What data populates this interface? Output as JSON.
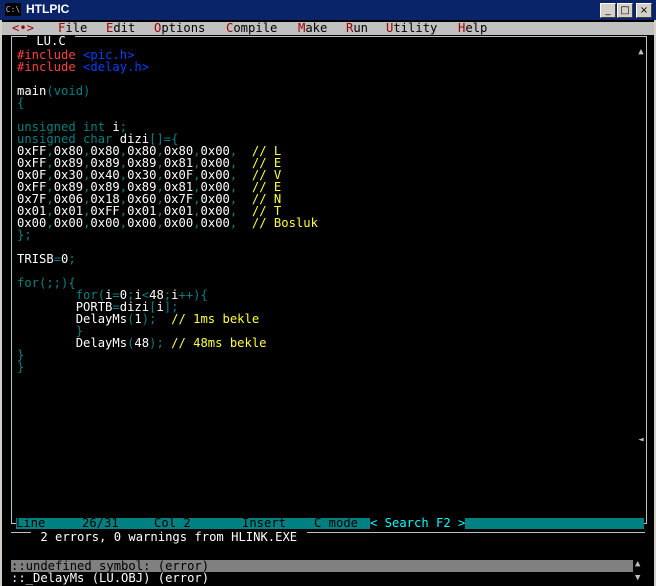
{
  "window": {
    "title": "HTLPIC",
    "icon": "console-icon",
    "min": "_",
    "max": "□",
    "close": "×"
  },
  "menu": [
    {
      "pre": "",
      "hk": "<•>",
      "post": ""
    },
    {
      "pre": "",
      "hk": "F",
      "post": "ile"
    },
    {
      "pre": "",
      "hk": "E",
      "post": "dit"
    },
    {
      "pre": "",
      "hk": "O",
      "post": "ptions"
    },
    {
      "pre": "",
      "hk": "C",
      "post": "ompile"
    },
    {
      "pre": "",
      "hk": "M",
      "post": "ake"
    },
    {
      "pre": "",
      "hk": "R",
      "post": "un"
    },
    {
      "pre": "",
      "hk": "U",
      "post": "tility"
    },
    {
      "pre": "",
      "hk": "H",
      "post": "elp"
    }
  ],
  "editor": {
    "file_title": " LU.C ",
    "lines": [
      [
        {
          "c": "rd",
          "t": "#include "
        },
        {
          "c": "bl",
          "t": "<pic.h>"
        }
      ],
      [
        {
          "c": "rd",
          "t": "#include "
        },
        {
          "c": "bl",
          "t": "<delay.h>"
        }
      ],
      [],
      [
        {
          "c": "wt",
          "t": "main"
        },
        {
          "c": "dk",
          "t": "(void)"
        }
      ],
      [
        {
          "c": "dk",
          "t": "{"
        }
      ],
      [],
      [
        {
          "c": "dk",
          "t": "unsigned int "
        },
        {
          "c": "wt",
          "t": "i"
        },
        {
          "c": "dk",
          "t": ";"
        }
      ],
      [
        {
          "c": "dk",
          "t": "unsigned char "
        },
        {
          "c": "wt",
          "t": "dizi"
        },
        {
          "c": "dk",
          "t": "[]={"
        }
      ],
      [
        {
          "c": "wt",
          "t": "0xFF"
        },
        {
          "c": "dk",
          "t": ","
        },
        {
          "c": "wt",
          "t": "0x80"
        },
        {
          "c": "dk",
          "t": ","
        },
        {
          "c": "wt",
          "t": "0x80"
        },
        {
          "c": "dk",
          "t": ","
        },
        {
          "c": "wt",
          "t": "0x80"
        },
        {
          "c": "dk",
          "t": ","
        },
        {
          "c": "wt",
          "t": "0x80"
        },
        {
          "c": "dk",
          "t": ","
        },
        {
          "c": "wt",
          "t": "0x00"
        },
        {
          "c": "dk",
          "t": ",  "
        },
        {
          "c": "yl",
          "t": "// L"
        }
      ],
      [
        {
          "c": "wt",
          "t": "0xFF"
        },
        {
          "c": "dk",
          "t": ","
        },
        {
          "c": "wt",
          "t": "0x89"
        },
        {
          "c": "dk",
          "t": ","
        },
        {
          "c": "wt",
          "t": "0x89"
        },
        {
          "c": "dk",
          "t": ","
        },
        {
          "c": "wt",
          "t": "0x89"
        },
        {
          "c": "dk",
          "t": ","
        },
        {
          "c": "wt",
          "t": "0x81"
        },
        {
          "c": "dk",
          "t": ","
        },
        {
          "c": "wt",
          "t": "0x00"
        },
        {
          "c": "dk",
          "t": ",  "
        },
        {
          "c": "yl",
          "t": "// E"
        }
      ],
      [
        {
          "c": "wt",
          "t": "0x0F"
        },
        {
          "c": "dk",
          "t": ","
        },
        {
          "c": "wt",
          "t": "0x30"
        },
        {
          "c": "dk",
          "t": ","
        },
        {
          "c": "wt",
          "t": "0x40"
        },
        {
          "c": "dk",
          "t": ","
        },
        {
          "c": "wt",
          "t": "0x30"
        },
        {
          "c": "dk",
          "t": ","
        },
        {
          "c": "wt",
          "t": "0x0F"
        },
        {
          "c": "dk",
          "t": ","
        },
        {
          "c": "wt",
          "t": "0x00"
        },
        {
          "c": "dk",
          "t": ",  "
        },
        {
          "c": "yl",
          "t": "// V"
        }
      ],
      [
        {
          "c": "wt",
          "t": "0xFF"
        },
        {
          "c": "dk",
          "t": ","
        },
        {
          "c": "wt",
          "t": "0x89"
        },
        {
          "c": "dk",
          "t": ","
        },
        {
          "c": "wt",
          "t": "0x89"
        },
        {
          "c": "dk",
          "t": ","
        },
        {
          "c": "wt",
          "t": "0x89"
        },
        {
          "c": "dk",
          "t": ","
        },
        {
          "c": "wt",
          "t": "0x81"
        },
        {
          "c": "dk",
          "t": ","
        },
        {
          "c": "wt",
          "t": "0x00"
        },
        {
          "c": "dk",
          "t": ",  "
        },
        {
          "c": "yl",
          "t": "// E"
        }
      ],
      [
        {
          "c": "wt",
          "t": "0x7F"
        },
        {
          "c": "dk",
          "t": ","
        },
        {
          "c": "wt",
          "t": "0x06"
        },
        {
          "c": "dk",
          "t": ","
        },
        {
          "c": "wt",
          "t": "0x18"
        },
        {
          "c": "dk",
          "t": ","
        },
        {
          "c": "wt",
          "t": "0x60"
        },
        {
          "c": "dk",
          "t": ","
        },
        {
          "c": "wt",
          "t": "0x7F"
        },
        {
          "c": "dk",
          "t": ","
        },
        {
          "c": "wt",
          "t": "0x00"
        },
        {
          "c": "dk",
          "t": ",  "
        },
        {
          "c": "yl",
          "t": "// N"
        }
      ],
      [
        {
          "c": "wt",
          "t": "0x01"
        },
        {
          "c": "dk",
          "t": ","
        },
        {
          "c": "wt",
          "t": "0x01"
        },
        {
          "c": "dk",
          "t": ","
        },
        {
          "c": "wt",
          "t": "0xFF"
        },
        {
          "c": "dk",
          "t": ","
        },
        {
          "c": "wt",
          "t": "0x01"
        },
        {
          "c": "dk",
          "t": ","
        },
        {
          "c": "wt",
          "t": "0x01"
        },
        {
          "c": "dk",
          "t": ","
        },
        {
          "c": "wt",
          "t": "0x00"
        },
        {
          "c": "dk",
          "t": ",  "
        },
        {
          "c": "yl",
          "t": "// T"
        }
      ],
      [
        {
          "c": "wt",
          "t": "0x00"
        },
        {
          "c": "dk",
          "t": ","
        },
        {
          "c": "wt",
          "t": "0x00"
        },
        {
          "c": "dk",
          "t": ","
        },
        {
          "c": "wt",
          "t": "0x00"
        },
        {
          "c": "dk",
          "t": ","
        },
        {
          "c": "wt",
          "t": "0x00"
        },
        {
          "c": "dk",
          "t": ","
        },
        {
          "c": "wt",
          "t": "0x00"
        },
        {
          "c": "dk",
          "t": ","
        },
        {
          "c": "wt",
          "t": "0x00"
        },
        {
          "c": "dk",
          "t": ",  "
        },
        {
          "c": "yl",
          "t": "// Bosluk"
        }
      ],
      [
        {
          "c": "dk",
          "t": "};"
        }
      ],
      [],
      [
        {
          "c": "wt",
          "t": "TRISB"
        },
        {
          "c": "dk",
          "t": "="
        },
        {
          "c": "wt",
          "t": "0"
        },
        {
          "c": "dk",
          "t": ";"
        }
      ],
      [],
      [
        {
          "c": "dk",
          "t": "for(;;){"
        }
      ],
      [
        {
          "c": "dk",
          "t": "        for("
        },
        {
          "c": "wt",
          "t": "i"
        },
        {
          "c": "dk",
          "t": "="
        },
        {
          "c": "wt",
          "t": "0"
        },
        {
          "c": "dk",
          "t": ";"
        },
        {
          "c": "wt",
          "t": "i"
        },
        {
          "c": "dk",
          "t": "<"
        },
        {
          "c": "wt",
          "t": "48"
        },
        {
          "c": "dk",
          "t": ";"
        },
        {
          "c": "wt",
          "t": "i"
        },
        {
          "c": "dk",
          "t": "++){"
        }
      ],
      [
        {
          "c": "dk",
          "t": "        "
        },
        {
          "c": "wt",
          "t": "PORTB"
        },
        {
          "c": "dk",
          "t": "="
        },
        {
          "c": "wt",
          "t": "dizi"
        },
        {
          "c": "dk",
          "t": "["
        },
        {
          "c": "wt",
          "t": "i"
        },
        {
          "c": "dk",
          "t": "];"
        }
      ],
      [
        {
          "c": "dk",
          "t": "        "
        },
        {
          "c": "wt",
          "t": "DelayMs"
        },
        {
          "c": "dk",
          "t": "("
        },
        {
          "c": "wt",
          "t": "1"
        },
        {
          "c": "dk",
          "t": ");  "
        },
        {
          "c": "yl",
          "t": "// 1ms bekle"
        }
      ],
      [
        {
          "c": "dk",
          "t": "        }"
        }
      ],
      [
        {
          "c": "dk",
          "t": "        "
        },
        {
          "c": "wt",
          "t": "DelayMs"
        },
        {
          "c": "dk",
          "t": "("
        },
        {
          "c": "wt",
          "t": "48"
        },
        {
          "c": "dk",
          "t": "); "
        },
        {
          "c": "yl",
          "t": "// 48ms bekle"
        }
      ],
      [
        {
          "c": "dk",
          "t": "}"
        }
      ],
      [
        {
          "c": "dk",
          "t": "}"
        }
      ]
    ]
  },
  "status": {
    "line_label": "Line",
    "line_value": "26/31",
    "col": "Col 2",
    "mode": "Insert",
    "lang": "C mode",
    "search": "< Search F2 >"
  },
  "messages": {
    "title": " 2 errors, 0 warnings from HLINK.EXE ",
    "items": [
      "::undefined symbol: (error)",
      "::_DelayMs (LU.OBJ) (error)"
    ]
  }
}
